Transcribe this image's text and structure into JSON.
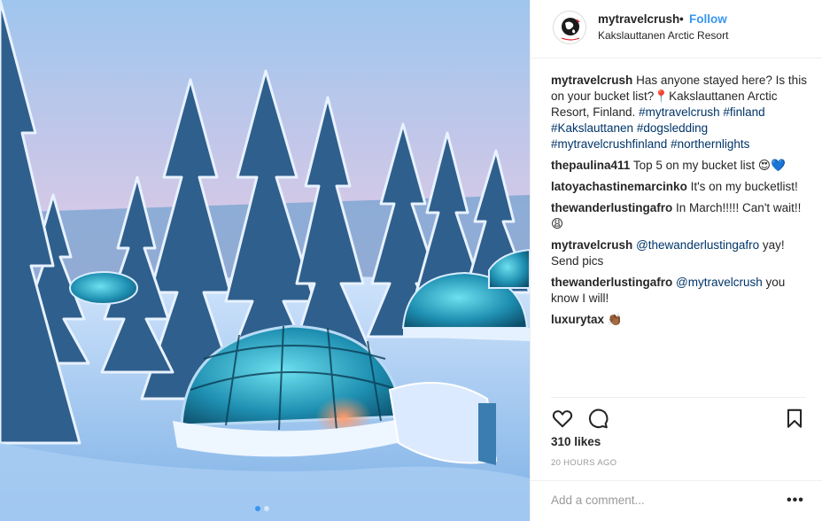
{
  "post": {
    "username": "mytravelcrush",
    "separator": "•",
    "follow_label": "Follow",
    "location": "Kakslauttanen Arctic Resort",
    "avatar_icon": "globe-logo-icon"
  },
  "caption": {
    "user": "mytravelcrush",
    "text_1": "Has anyone stayed here? Is this on your bucket list?",
    "pin_emoji": "📍",
    "text_2": "Kakslauttanen Arctic Resort, Finland.",
    "hashtags": [
      "#mytravelcrush",
      "#finland",
      "#Kakslauttanen",
      "#dogsledding",
      "#mytravelcrushfinland",
      "#northernlights"
    ]
  },
  "comments": [
    {
      "user": "thepaulina411",
      "text": "Top 5 on my bucket list",
      "emoji": "😍💙"
    },
    {
      "user": "latoyachastinemarcinko",
      "text": "It's on my bucketlist!",
      "emoji": ""
    },
    {
      "user": "thewanderlustingafro",
      "text": "In March!!!!! Can't wait!!",
      "emoji": "😩"
    },
    {
      "user": "mytravelcrush",
      "mention": "@thewanderlustingafro",
      "text": "yay! Send pics",
      "emoji": ""
    },
    {
      "user": "thewanderlustingafro",
      "mention": "@mytravelcrush",
      "text": "you know I will!",
      "emoji": ""
    },
    {
      "user": "luxurytax",
      "text": "",
      "emoji": "👏🏾"
    }
  ],
  "actions": {
    "like_icon": "heart-icon",
    "comment_icon": "comment-icon",
    "save_icon": "bookmark-icon"
  },
  "likes": "310 likes",
  "timestamp": "20 HOURS AGO",
  "add_comment": {
    "placeholder": "Add a comment...",
    "more_label": "•••"
  },
  "colors": {
    "link_blue": "#3897f0",
    "hashtag_blue": "#003569",
    "muted": "#999999"
  }
}
